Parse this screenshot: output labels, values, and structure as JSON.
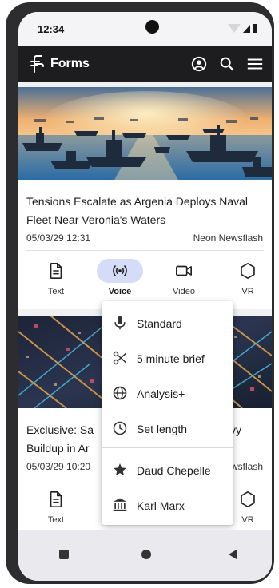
{
  "status_bar": {
    "time": "12:34"
  },
  "app_bar": {
    "title": "Forms",
    "icons": [
      "forms-logo-icon",
      "account-circle-icon",
      "search-icon",
      "menu-icon"
    ]
  },
  "articles": [
    {
      "image": "naval-fleet-illustration",
      "headline": "Tensions Escalate as Argenia Deploys Naval Fleet Near Veronia's Waters",
      "date": "05/03/29 12:31",
      "source": "Neon Newsflash",
      "actions": [
        {
          "label": "Text",
          "icon": "document-icon"
        },
        {
          "label": "Voice",
          "icon": "broadcast-icon",
          "selected": true
        },
        {
          "label": "Video",
          "icon": "video-camera-icon"
        },
        {
          "label": "VR",
          "icon": "hexagon-icon"
        }
      ]
    },
    {
      "image": "neon-city-aerial-illustration",
      "headline_visible_left": "Exclusive: Sa",
      "headline_visible_right": "vy",
      "headline_line2_visible": "Buildup in Ar",
      "date_visible": "05/03/29 10:20",
      "source_visible": "ewsflash",
      "actions": [
        {
          "label": "Text",
          "icon": "document-icon"
        },
        {
          "label": "VR",
          "icon": "hexagon-icon"
        }
      ]
    }
  ],
  "voice_menu": {
    "items": [
      {
        "label": "Standard",
        "icon": "microphone-icon"
      },
      {
        "label": "5 minute brief",
        "icon": "scissors-icon"
      },
      {
        "label": "Analysis+",
        "icon": "globe-icon"
      },
      {
        "label": "Set length",
        "icon": "clock-icon"
      },
      {
        "label": "Daud Chepelle",
        "icon": "star-icon"
      },
      {
        "label": "Karl Marx",
        "icon": "museum-icon"
      }
    ]
  },
  "nav_bar": {
    "icons": [
      "back-square-icon",
      "home-circle-icon",
      "recents-triangle-icon"
    ]
  },
  "colors": {
    "app_bar": "#1d1d1f",
    "selected_pill": "#d4dcf8",
    "background": "#f1f1f4"
  }
}
